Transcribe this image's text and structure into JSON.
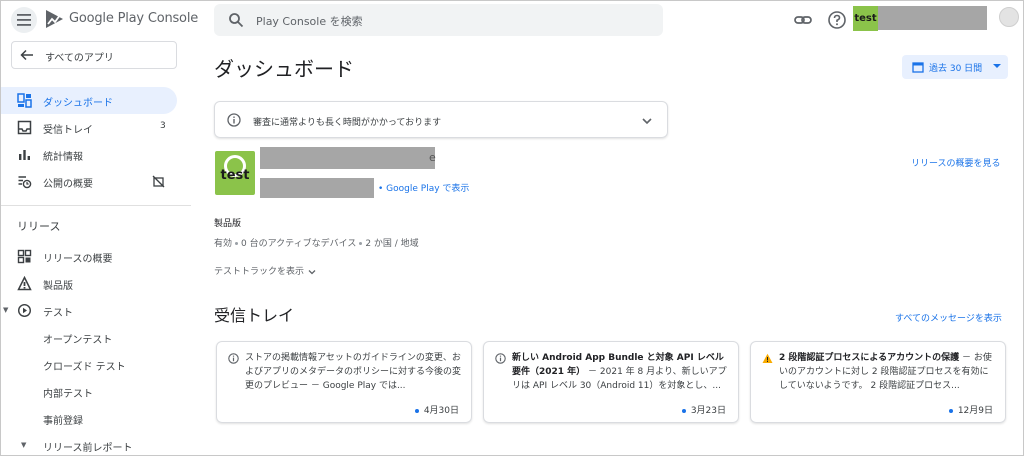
{
  "header": {
    "brand": "Google Play Console",
    "search_placeholder": "Play Console を検索",
    "app_thumb_text": "test"
  },
  "sidebar": {
    "all_apps": "すべてのアプリ",
    "items": [
      {
        "label": "ダッシュボード",
        "icon": "dashboard-icon",
        "active": true
      },
      {
        "label": "受信トレイ",
        "icon": "inbox-icon",
        "count": "3"
      },
      {
        "label": "統計情報",
        "icon": "bar-chart-icon"
      },
      {
        "label": "公開の概要",
        "icon": "publishing-overview-icon"
      }
    ],
    "release_section": "リリース",
    "release_items": [
      {
        "label": "リリースの概要",
        "icon": "release-overview-icon"
      },
      {
        "label": "製品版",
        "icon": "production-icon"
      },
      {
        "label": "テスト",
        "icon": "testing-icon"
      }
    ],
    "test_sub_items": [
      "オープンテスト",
      "クローズド テスト",
      "内部テスト",
      "事前登録"
    ],
    "pre_launch": "リリース前レポート"
  },
  "main": {
    "title": "ダッシュボード",
    "date_range": "過去 30 日間",
    "notice": "審査に通常よりも長く時間がかかっております",
    "app": {
      "icon_text": "test",
      "name_tail": "e",
      "view_link": "Google Play で表示",
      "release_link": "リリースの概要を見る"
    },
    "production": {
      "title": "製品版",
      "status": "有効",
      "devices": "0 台のアクティブなデバイス",
      "countries": "2 か国 / 地域"
    },
    "show_tracks": "テストトラックを表示",
    "inbox": {
      "title": "受信トレイ",
      "all_messages": "すべてのメッセージを表示",
      "cards": [
        {
          "icon": "info-icon",
          "bold": "",
          "text": "ストアの掲載情報アセットのガイドラインの変更、およびアプリのメタデータのポリシーに対する今後の変更のプレビュー － Google Play では...",
          "date": "4月30日"
        },
        {
          "icon": "info-icon",
          "bold": "新しい Android App Bundle と対象 API レベル要件（2021 年）",
          "text": " － 2021 年 8 月より、新しいアプリは API レベル 30（Android 11）を対象とし、...",
          "date": "3月23日"
        },
        {
          "icon": "warning-icon",
          "bold": "2 段階認証プロセスによるアカウントの保護",
          "text": " － お使いのアカウントに対し 2 段階認証プロセスを有効にしていないようです。 2 段階認証プロセス...",
          "date": "12月9日"
        }
      ]
    }
  },
  "colors": {
    "accent": "#1a73e8",
    "active_bg": "#e8f0fe",
    "app_green": "#8bc34a",
    "warning": "#f9ab00"
  }
}
